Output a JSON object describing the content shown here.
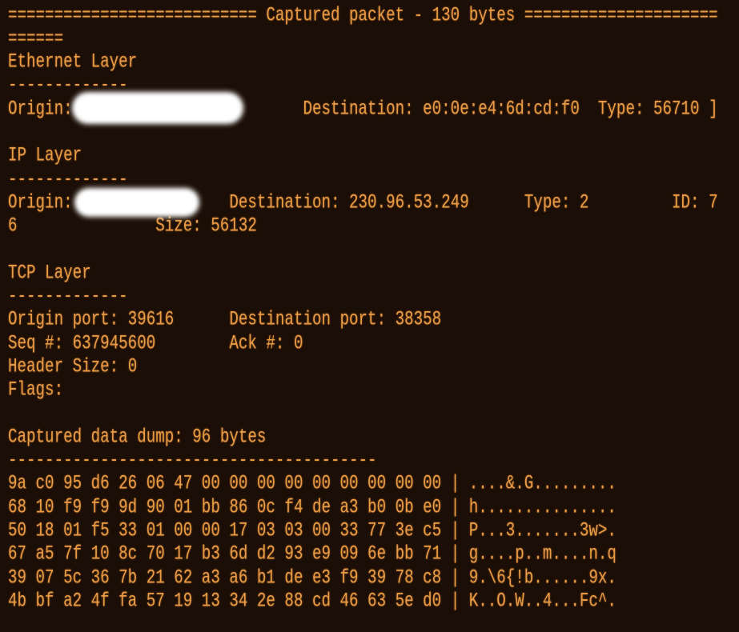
{
  "theme": {
    "background": "#1b0e06",
    "text": "#e99c45",
    "redaction": "#ffffff"
  },
  "header": {
    "rule_left": "===========================",
    "title": "Captured packet - 130 bytes",
    "rule_right": "=====================",
    "rule_right_wrap": "======"
  },
  "ethernet": {
    "heading": "Ethernet Layer",
    "underline": "-------------",
    "origin_label": "Origin:",
    "destination_label": "Destination:",
    "destination_value": "e0:0e:e4:6d:cd:f0",
    "type_label": "Type:",
    "type_value": "56710",
    "suffix": "]"
  },
  "ip": {
    "heading": "IP Layer",
    "underline": "-------------",
    "origin_label": "Origin:",
    "destination_label": "Destination:",
    "destination_value": "230.96.53.249",
    "type_label": "Type:",
    "type_value": "2",
    "id_label": "ID:",
    "id_value": "7",
    "id_value_wrap": "6",
    "size_label": "Size:",
    "size_value": "56132"
  },
  "tcp": {
    "heading": "TCP Layer",
    "underline": "-------------",
    "origin_port_label": "Origin port:",
    "origin_port_value": "39616",
    "destination_port_label": "Destination port:",
    "destination_port_value": "38358",
    "seq_label": "Seq #:",
    "seq_value": "637945600",
    "ack_label": "Ack #:",
    "ack_value": "0",
    "header_size_label": "Header Size:",
    "header_size_value": "0",
    "flags_label": "Flags:"
  },
  "dump": {
    "heading": "Captured data dump: 96 bytes",
    "underline": "----------------------------------------",
    "separator": "|",
    "rows": [
      {
        "hex": "9a c0 95 d6 26 06 47 00 00 00 00 00 00 00 00 00",
        "ascii": "....&.G........."
      },
      {
        "hex": "68 10 f9 f9 9d 90 01 bb 86 0c f4 de a3 b0 0b e0",
        "ascii": "h..............."
      },
      {
        "hex": "50 18 01 f5 33 01 00 00 17 03 03 00 33 77 3e c5",
        "ascii": "P...3.......3w>."
      },
      {
        "hex": "67 a5 7f 10 8c 70 17 b3 6d d2 93 e9 09 6e bb 71",
        "ascii": "g....p..m....n.q"
      },
      {
        "hex": "39 07 5c 36 7b 21 62 a3 a6 b1 de e3 f9 39 78 c8",
        "ascii": "9.\\6{!b......9x."
      },
      {
        "hex": "4b bf a2 4f fa 57 19 13 34 2e 88 cd 46 63 5e d0",
        "ascii": "K..O.W..4...Fc^."
      }
    ]
  }
}
